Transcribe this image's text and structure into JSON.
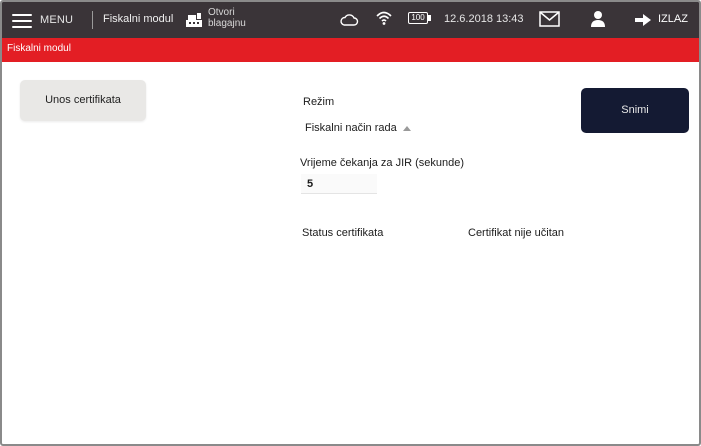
{
  "topbar": {
    "menu_label": "MENU",
    "module_title": "Fiskalni modul",
    "register_line1": "Otvori",
    "register_line2": "blagajnu",
    "battery": "100",
    "datetime": "12.6.2018 13:43",
    "logout_label": "IZLAZ"
  },
  "section": {
    "title": "Fiskalni modul"
  },
  "actions": {
    "cert_button": "Unos certifikata",
    "save_button": "Snimi"
  },
  "form": {
    "mode_label": "Režim",
    "mode_value": "Fiskalni način rada",
    "jir_label": "Vrijeme čekanja za JIR (sekunde)",
    "jir_value": "5",
    "status_label": "Status certifikata",
    "status_value": "Certifikat nije učitan"
  },
  "colors": {
    "topbar": "#3a3438",
    "accent_red": "#e31e24",
    "save_button": "#141a33",
    "cert_button": "#e9e8e6"
  },
  "icons": [
    "hamburger-icon",
    "cash-register-icon",
    "cloud-icon",
    "wifi-icon",
    "battery-icon",
    "mail-icon",
    "user-icon",
    "logout-arrow-icon",
    "caret-up-icon"
  ]
}
